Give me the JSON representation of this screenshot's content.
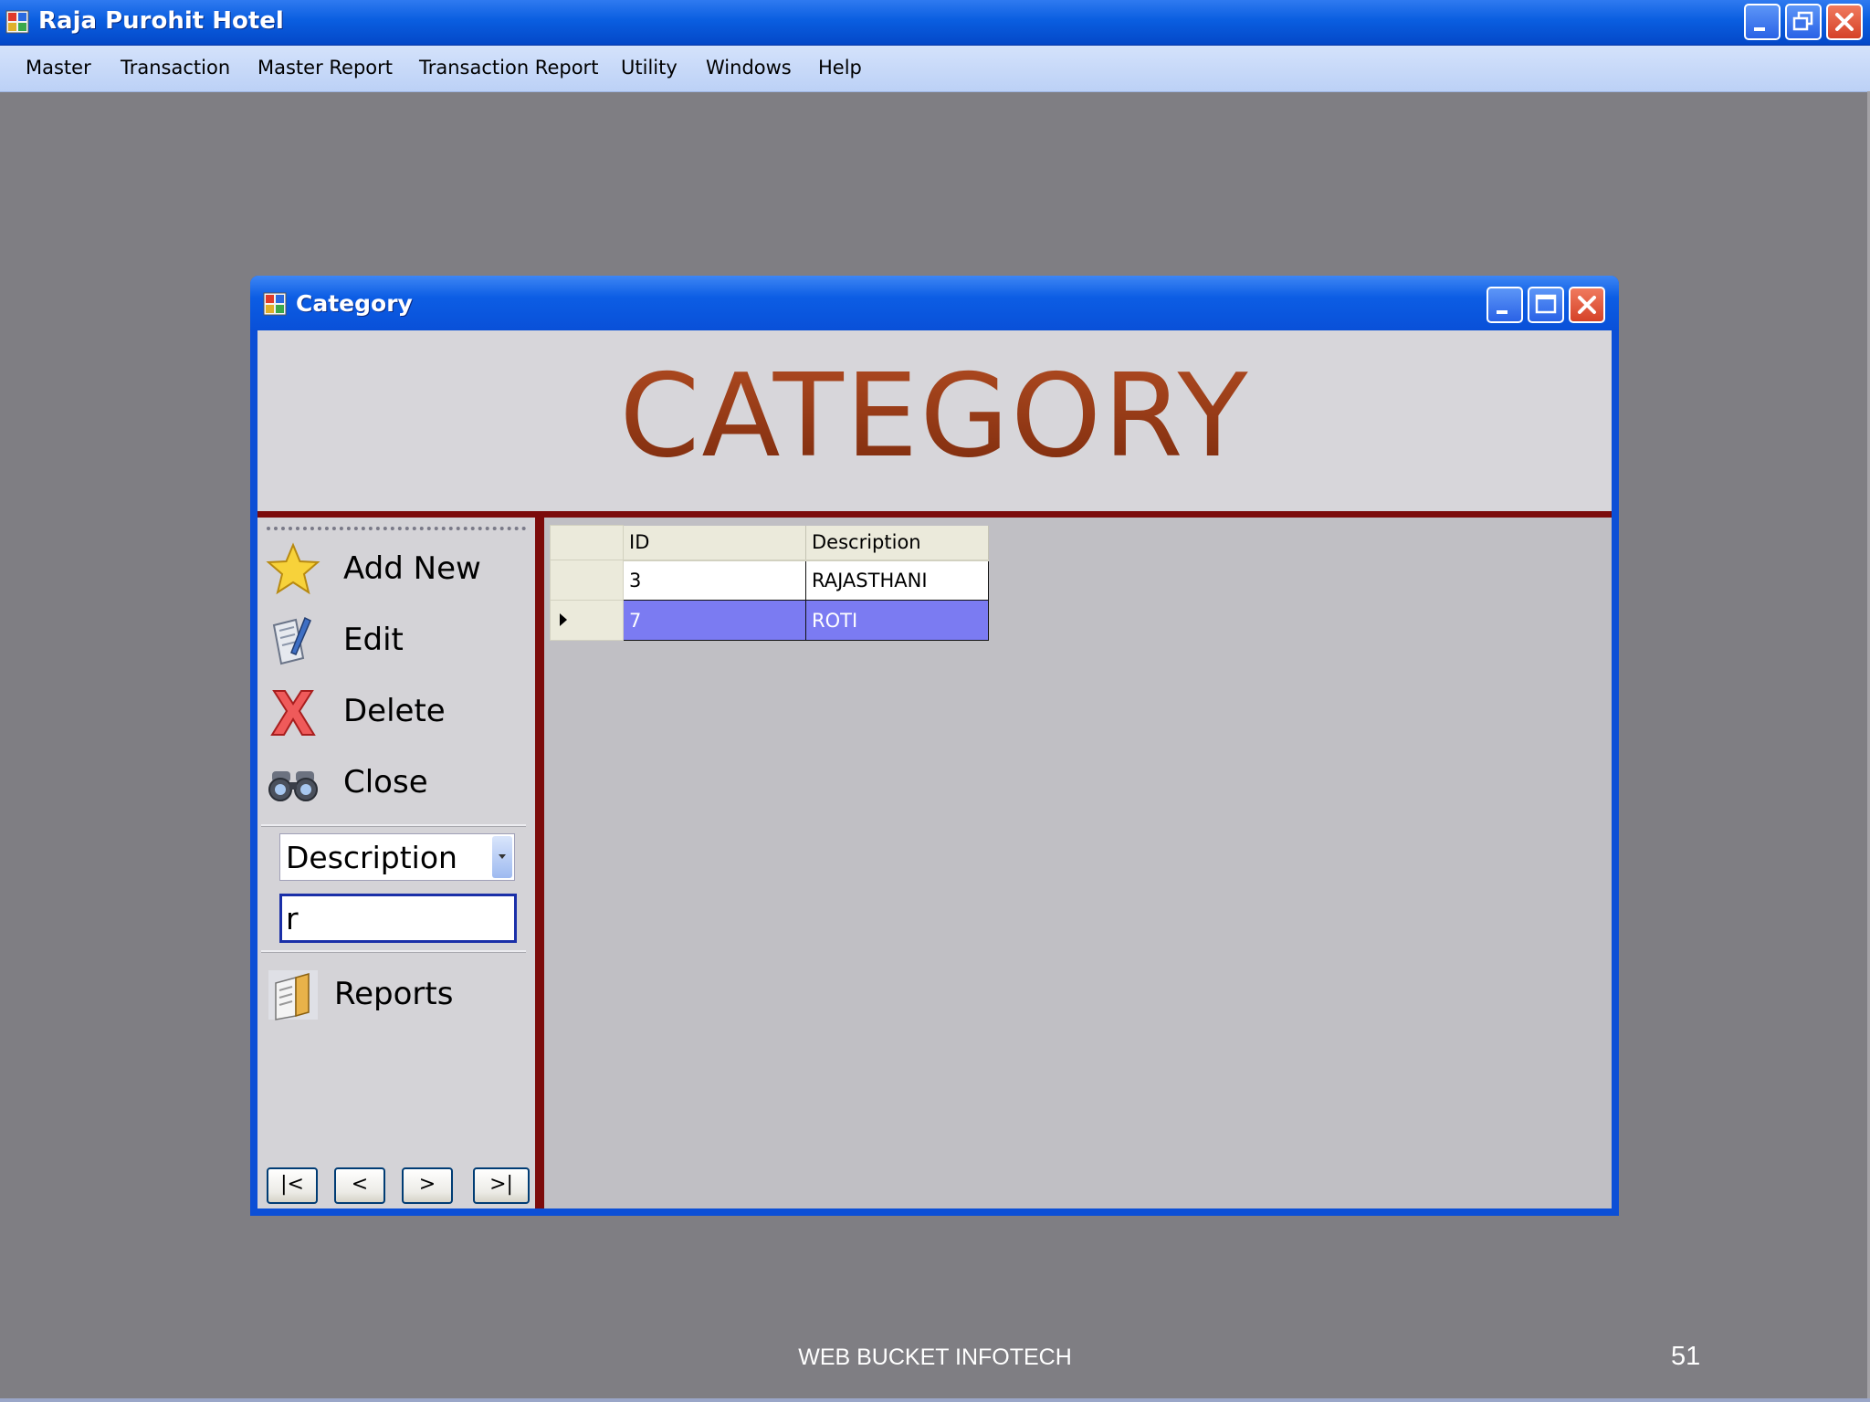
{
  "app": {
    "title": "Raja Purohit Hotel"
  },
  "menu": [
    {
      "label": "Master"
    },
    {
      "label": "Transaction"
    },
    {
      "label": "Master Report"
    },
    {
      "label": "Transaction Report"
    },
    {
      "label": "Utility"
    },
    {
      "label": "Windows"
    },
    {
      "label": "Help"
    }
  ],
  "child_window": {
    "title": "Category",
    "banner": "CATEGORY"
  },
  "actions": {
    "add_new": "Add New",
    "edit": "Edit",
    "delete": "Delete",
    "close": "Close",
    "reports": "Reports"
  },
  "search": {
    "field_selected": "Description",
    "query": "r"
  },
  "navigation": {
    "first": "|<",
    "prev": "<",
    "next": ">",
    "last": ">|"
  },
  "grid": {
    "columns": [
      "ID",
      "Description"
    ],
    "rows": [
      {
        "id": "3",
        "description": "RAJASTHANI"
      },
      {
        "id": "7",
        "description": "ROTI"
      }
    ],
    "selected_row": 1,
    "selection_color": "#7b7bf2"
  },
  "footer": {
    "company": "WEB BUCKET INFOTECH",
    "page": "51"
  }
}
